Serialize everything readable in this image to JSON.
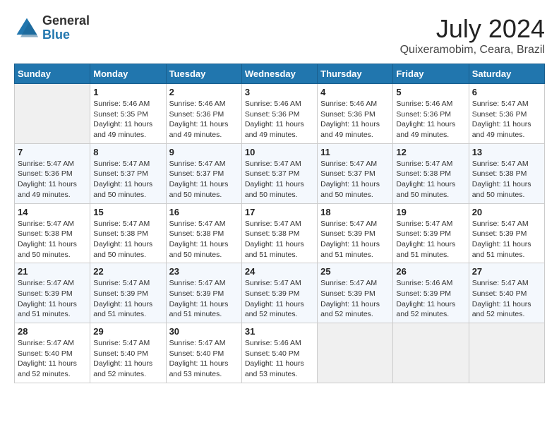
{
  "header": {
    "logo_general": "General",
    "logo_blue": "Blue",
    "month_year": "July 2024",
    "location": "Quixeramobim, Ceara, Brazil"
  },
  "weekdays": [
    "Sunday",
    "Monday",
    "Tuesday",
    "Wednesday",
    "Thursday",
    "Friday",
    "Saturday"
  ],
  "weeks": [
    [
      {
        "day": "",
        "info": ""
      },
      {
        "day": "1",
        "info": "Sunrise: 5:46 AM\nSunset: 5:35 PM\nDaylight: 11 hours\nand 49 minutes."
      },
      {
        "day": "2",
        "info": "Sunrise: 5:46 AM\nSunset: 5:36 PM\nDaylight: 11 hours\nand 49 minutes."
      },
      {
        "day": "3",
        "info": "Sunrise: 5:46 AM\nSunset: 5:36 PM\nDaylight: 11 hours\nand 49 minutes."
      },
      {
        "day": "4",
        "info": "Sunrise: 5:46 AM\nSunset: 5:36 PM\nDaylight: 11 hours\nand 49 minutes."
      },
      {
        "day": "5",
        "info": "Sunrise: 5:46 AM\nSunset: 5:36 PM\nDaylight: 11 hours\nand 49 minutes."
      },
      {
        "day": "6",
        "info": "Sunrise: 5:47 AM\nSunset: 5:36 PM\nDaylight: 11 hours\nand 49 minutes."
      }
    ],
    [
      {
        "day": "7",
        "info": "Sunrise: 5:47 AM\nSunset: 5:36 PM\nDaylight: 11 hours\nand 49 minutes."
      },
      {
        "day": "8",
        "info": "Sunrise: 5:47 AM\nSunset: 5:37 PM\nDaylight: 11 hours\nand 50 minutes."
      },
      {
        "day": "9",
        "info": "Sunrise: 5:47 AM\nSunset: 5:37 PM\nDaylight: 11 hours\nand 50 minutes."
      },
      {
        "day": "10",
        "info": "Sunrise: 5:47 AM\nSunset: 5:37 PM\nDaylight: 11 hours\nand 50 minutes."
      },
      {
        "day": "11",
        "info": "Sunrise: 5:47 AM\nSunset: 5:37 PM\nDaylight: 11 hours\nand 50 minutes."
      },
      {
        "day": "12",
        "info": "Sunrise: 5:47 AM\nSunset: 5:38 PM\nDaylight: 11 hours\nand 50 minutes."
      },
      {
        "day": "13",
        "info": "Sunrise: 5:47 AM\nSunset: 5:38 PM\nDaylight: 11 hours\nand 50 minutes."
      }
    ],
    [
      {
        "day": "14",
        "info": "Sunrise: 5:47 AM\nSunset: 5:38 PM\nDaylight: 11 hours\nand 50 minutes."
      },
      {
        "day": "15",
        "info": "Sunrise: 5:47 AM\nSunset: 5:38 PM\nDaylight: 11 hours\nand 50 minutes."
      },
      {
        "day": "16",
        "info": "Sunrise: 5:47 AM\nSunset: 5:38 PM\nDaylight: 11 hours\nand 50 minutes."
      },
      {
        "day": "17",
        "info": "Sunrise: 5:47 AM\nSunset: 5:38 PM\nDaylight: 11 hours\nand 51 minutes."
      },
      {
        "day": "18",
        "info": "Sunrise: 5:47 AM\nSunset: 5:39 PM\nDaylight: 11 hours\nand 51 minutes."
      },
      {
        "day": "19",
        "info": "Sunrise: 5:47 AM\nSunset: 5:39 PM\nDaylight: 11 hours\nand 51 minutes."
      },
      {
        "day": "20",
        "info": "Sunrise: 5:47 AM\nSunset: 5:39 PM\nDaylight: 11 hours\nand 51 minutes."
      }
    ],
    [
      {
        "day": "21",
        "info": "Sunrise: 5:47 AM\nSunset: 5:39 PM\nDaylight: 11 hours\nand 51 minutes."
      },
      {
        "day": "22",
        "info": "Sunrise: 5:47 AM\nSunset: 5:39 PM\nDaylight: 11 hours\nand 51 minutes."
      },
      {
        "day": "23",
        "info": "Sunrise: 5:47 AM\nSunset: 5:39 PM\nDaylight: 11 hours\nand 51 minutes."
      },
      {
        "day": "24",
        "info": "Sunrise: 5:47 AM\nSunset: 5:39 PM\nDaylight: 11 hours\nand 52 minutes."
      },
      {
        "day": "25",
        "info": "Sunrise: 5:47 AM\nSunset: 5:39 PM\nDaylight: 11 hours\nand 52 minutes."
      },
      {
        "day": "26",
        "info": "Sunrise: 5:46 AM\nSunset: 5:39 PM\nDaylight: 11 hours\nand 52 minutes."
      },
      {
        "day": "27",
        "info": "Sunrise: 5:47 AM\nSunset: 5:40 PM\nDaylight: 11 hours\nand 52 minutes."
      }
    ],
    [
      {
        "day": "28",
        "info": "Sunrise: 5:47 AM\nSunset: 5:40 PM\nDaylight: 11 hours\nand 52 minutes."
      },
      {
        "day": "29",
        "info": "Sunrise: 5:47 AM\nSunset: 5:40 PM\nDaylight: 11 hours\nand 52 minutes."
      },
      {
        "day": "30",
        "info": "Sunrise: 5:47 AM\nSunset: 5:40 PM\nDaylight: 11 hours\nand 53 minutes."
      },
      {
        "day": "31",
        "info": "Sunrise: 5:46 AM\nSunset: 5:40 PM\nDaylight: 11 hours\nand 53 minutes."
      },
      {
        "day": "",
        "info": ""
      },
      {
        "day": "",
        "info": ""
      },
      {
        "day": "",
        "info": ""
      }
    ]
  ]
}
